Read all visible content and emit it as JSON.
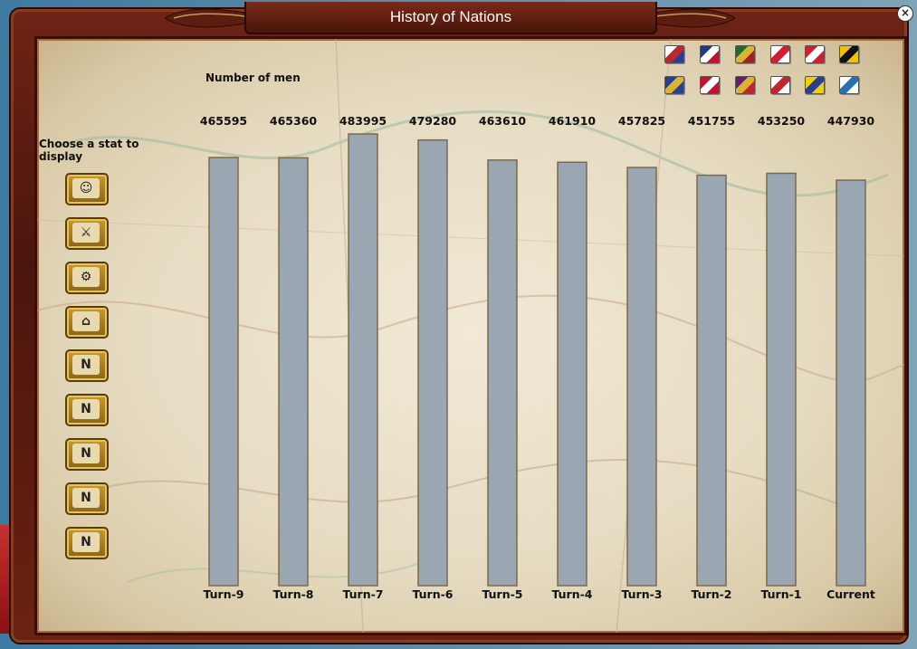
{
  "window": {
    "title": "History of Nations",
    "close_symbol": "×"
  },
  "sidebar": {
    "title": "Choose a stat to display",
    "buttons": [
      {
        "name": "stat-men-icon"
      },
      {
        "name": "stat-cannon-icon"
      },
      {
        "name": "stat-wagons-icon"
      },
      {
        "name": "stat-buildings-icon"
      },
      {
        "name": "stat-n-infantry-icon"
      },
      {
        "name": "stat-n-cavalry-icon"
      },
      {
        "name": "stat-n-artillery-icon"
      },
      {
        "name": "stat-n-casualties-icon"
      },
      {
        "name": "stat-n-flag-icon"
      }
    ]
  },
  "flags": {
    "row1": [
      {
        "name": "flag-1",
        "colors": [
          "#ffffff",
          "#c0272d",
          "#2a3f8f"
        ]
      },
      {
        "name": "flag-britain",
        "colors": [
          "#1f3a8a",
          "#ffffff",
          "#c8102e"
        ]
      },
      {
        "name": "flag-3",
        "colors": [
          "#1f6b2a",
          "#d9b430",
          "#a02020"
        ]
      },
      {
        "name": "flag-4",
        "colors": [
          "#ffffff",
          "#d21f2f",
          "#ffffff"
        ]
      },
      {
        "name": "flag-ottoman",
        "colors": [
          "#d21f2f",
          "#ffffff",
          "#d21f2f"
        ]
      },
      {
        "name": "flag-austria",
        "colors": [
          "#f2c200",
          "#111111",
          "#f2c200"
        ]
      }
    ],
    "row2": [
      {
        "name": "flag-7",
        "colors": [
          "#2a3f8f",
          "#d9b430",
          "#2a3f8f"
        ]
      },
      {
        "name": "flag-denmark",
        "colors": [
          "#c8102e",
          "#ffffff",
          "#c8102e"
        ]
      },
      {
        "name": "flag-9",
        "colors": [
          "#6a1a6a",
          "#d9b430",
          "#c0272d"
        ]
      },
      {
        "name": "flag-10",
        "colors": [
          "#ffffff",
          "#c0272d",
          "#ffffff"
        ]
      },
      {
        "name": "flag-11",
        "colors": [
          "#f2d000",
          "#2a3f8f",
          "#f2d000"
        ]
      },
      {
        "name": "flag-12",
        "colors": [
          "#ffffff",
          "#2a6fb0",
          "#ffffff"
        ]
      }
    ]
  },
  "chart_data": {
    "type": "bar",
    "title": "Number of men",
    "categories": [
      "Turn-9",
      "Turn-8",
      "Turn-7",
      "Turn-6",
      "Turn-5",
      "Turn-4",
      "Turn-3",
      "Turn-2",
      "Turn-1",
      "Current"
    ],
    "values": [
      465595,
      465360,
      483995,
      479280,
      463610,
      461910,
      457825,
      451755,
      453250,
      447930
    ],
    "value_labels": [
      "465595",
      "465360",
      "483995",
      "479280",
      "463610",
      "461910",
      "457825",
      "451755",
      "453250",
      "447930"
    ],
    "bar_color": "#9aa7b2",
    "bar_border": "#7a6a4a",
    "ylim": [
      0,
      483995
    ],
    "grid": false
  }
}
